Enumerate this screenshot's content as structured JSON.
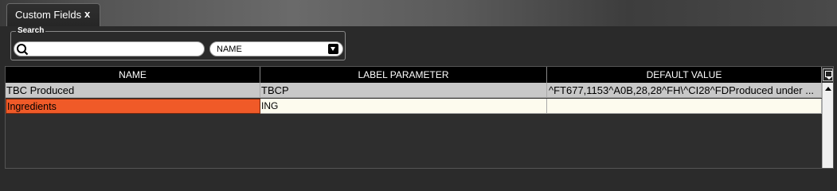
{
  "tab": {
    "title": "Custom Fields",
    "close_label": "x"
  },
  "search": {
    "legend": "Search",
    "query_value": "",
    "field_select_value": "NAME"
  },
  "grid": {
    "columns": [
      "NAME",
      "LABEL PARAMETER",
      "DEFAULT VALUE"
    ],
    "rows": [
      {
        "name": "TBC Produced",
        "label_parameter": "TBCP",
        "default_value": "^FT677,1153^A0B,28,28^FH\\^CI28^FDProduced under ..."
      },
      {
        "name": "Ingredients",
        "label_parameter": "ING",
        "default_value": ""
      }
    ]
  },
  "colors": {
    "selected_cell": "#f05a28",
    "header_bg": "#000000",
    "row_alt_bg": "#c8c8c8",
    "row_bg": "#fdfbee"
  }
}
